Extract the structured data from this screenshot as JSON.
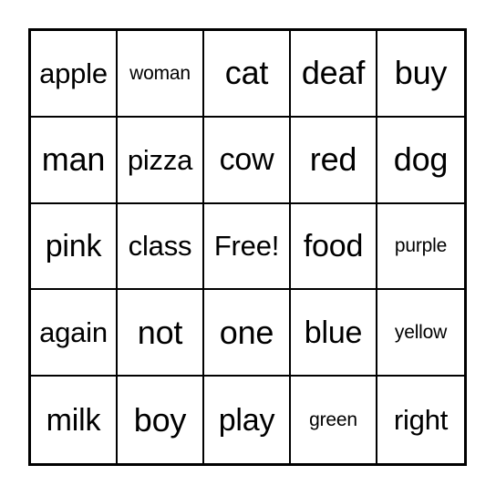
{
  "card": {
    "type": "bingo-card",
    "grid_size": 5,
    "free_space_label": "Free!",
    "free_space_position": {
      "row": 3,
      "col": 3
    },
    "border_color": "#000000",
    "background_color": "#ffffff",
    "text_color": "#000000",
    "rows": [
      {
        "cells": [
          {
            "label": "apple",
            "size": "md"
          },
          {
            "label": "woman",
            "size": "xs"
          },
          {
            "label": "cat",
            "size": "xl"
          },
          {
            "label": "deaf",
            "size": "xl"
          },
          {
            "label": "buy",
            "size": "xl"
          }
        ]
      },
      {
        "cells": [
          {
            "label": "man",
            "size": "xl"
          },
          {
            "label": "pizza",
            "size": "md"
          },
          {
            "label": "cow",
            "size": "lg"
          },
          {
            "label": "red",
            "size": "xl"
          },
          {
            "label": "dog",
            "size": "xl"
          }
        ]
      },
      {
        "cells": [
          {
            "label": "pink",
            "size": "lg"
          },
          {
            "label": "class",
            "size": "md"
          },
          {
            "label": "Free!",
            "size": "md"
          },
          {
            "label": "food",
            "size": "lg"
          },
          {
            "label": "purple",
            "size": "xs"
          }
        ]
      },
      {
        "cells": [
          {
            "label": "again",
            "size": "md"
          },
          {
            "label": "not",
            "size": "xl"
          },
          {
            "label": "one",
            "size": "xl"
          },
          {
            "label": "blue",
            "size": "lg"
          },
          {
            "label": "yellow",
            "size": "xs"
          }
        ]
      },
      {
        "cells": [
          {
            "label": "milk",
            "size": "lg"
          },
          {
            "label": "boy",
            "size": "xl"
          },
          {
            "label": "play",
            "size": "lg"
          },
          {
            "label": "green",
            "size": "xs"
          },
          {
            "label": "right",
            "size": "md"
          }
        ]
      }
    ]
  }
}
